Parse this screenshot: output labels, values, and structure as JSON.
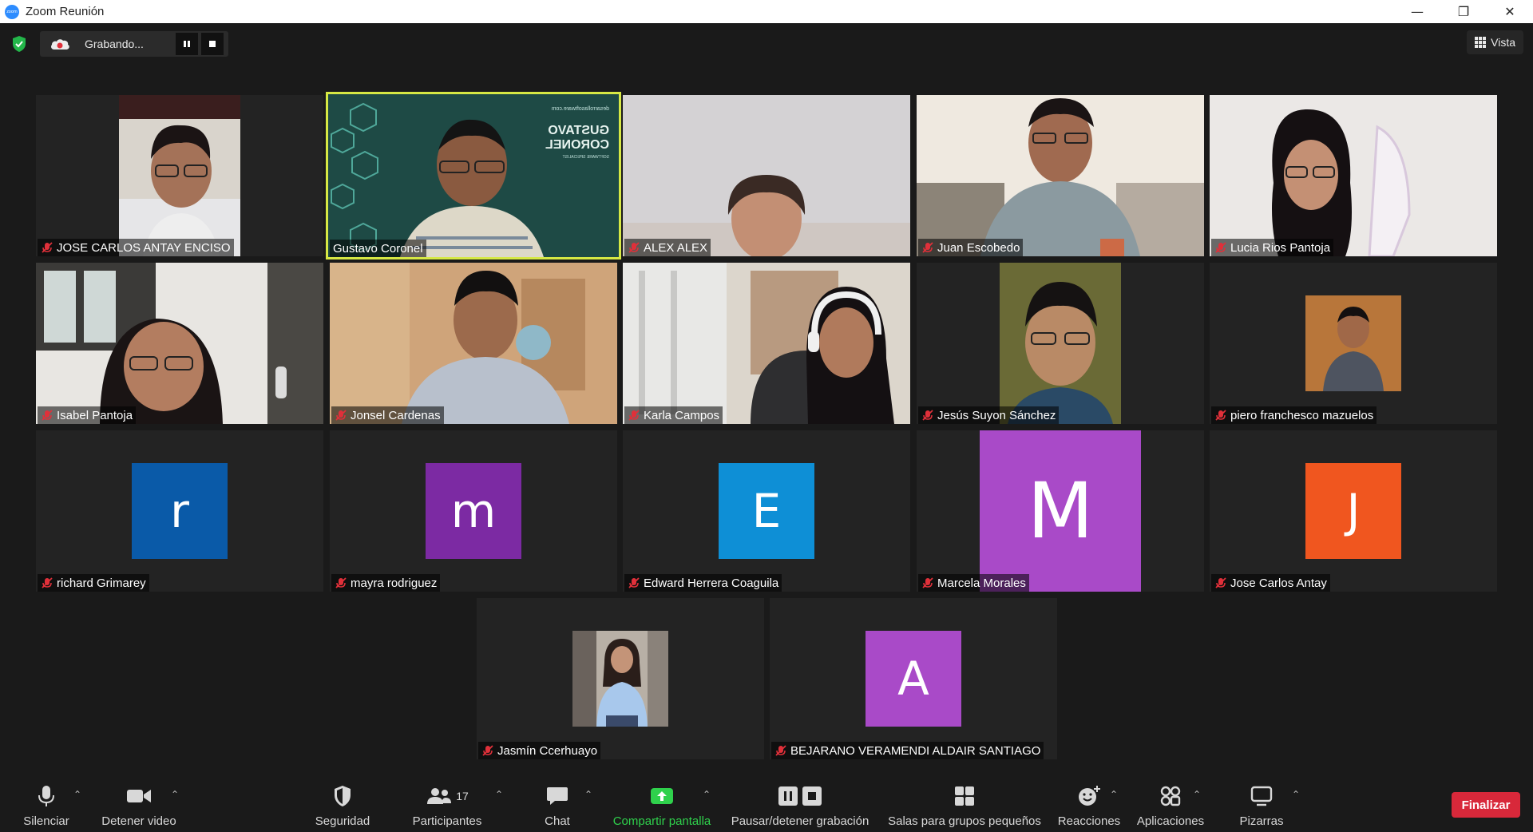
{
  "window": {
    "title": "Zoom Reunión",
    "app_icon_text": "zoom",
    "controls": {
      "minimize": "—",
      "restore": "❐",
      "close": "✕"
    }
  },
  "topbar": {
    "recording_label": "Grabando...",
    "view_label": "Vista"
  },
  "colors": {
    "active_speaker_border": "#d6e844",
    "end_button": "#d8283a",
    "share_green": "#2fd14c",
    "muted_red": "#e0303a"
  },
  "participants": [
    {
      "name": "JOSE CARLOS ANTAY ENCISO",
      "type": "video"
    },
    {
      "name": "Gustavo Coronel",
      "type": "video",
      "active": true
    },
    {
      "name": "ALEX ALEX",
      "type": "video"
    },
    {
      "name": "Juan Escobedo",
      "type": "video"
    },
    {
      "name": "Lucia Rios Pantoja",
      "type": "video"
    },
    {
      "name": "Isabel Pantoja",
      "type": "video"
    },
    {
      "name": "Jonsel Cardenas",
      "type": "video"
    },
    {
      "name": "Karla Campos",
      "type": "video"
    },
    {
      "name": "Jesús Suyon Sánchez",
      "type": "video"
    },
    {
      "name": "piero franchesco mazuelos",
      "type": "photo"
    },
    {
      "name": "richard Grimarey",
      "type": "avatar",
      "initial": "r",
      "color": "#0a5aa8"
    },
    {
      "name": "mayra rodriguez",
      "type": "avatar",
      "initial": "m",
      "color": "#7c2aa3"
    },
    {
      "name": "Edward Herrera Coaguila",
      "type": "avatar",
      "initial": "E",
      "color": "#0e8fd6"
    },
    {
      "name": "Marcela Morales",
      "type": "avatar",
      "initial": "M",
      "color": "#a94ac8"
    },
    {
      "name": "Jose Carlos Antay",
      "type": "avatar",
      "initial": "J",
      "color": "#f0561f"
    },
    {
      "name": "Jasmín Ccerhuayo",
      "type": "photo"
    },
    {
      "name": "BEJARANO VERAMENDI ALDAIR SANTIAGO",
      "type": "avatar",
      "initial": "A",
      "color": "#a94ac8"
    }
  ],
  "slide": {
    "line1": "GUSTAVO",
    "line2": "CORONEL",
    "line3": "SOFTWARE SPECIALIST",
    "url": "desarrollasoftware.com"
  },
  "toolbar": {
    "mute": "Silenciar",
    "video": "Detener video",
    "security": "Seguridad",
    "participants": "Participantes",
    "participants_count": "17",
    "chat": "Chat",
    "share": "Compartir pantalla",
    "record": "Pausar/detener grabación",
    "breakout": "Salas para grupos pequeños",
    "reactions": "Reacciones",
    "apps": "Aplicaciones",
    "whiteboards": "Pizarras",
    "end": "Finalizar"
  }
}
